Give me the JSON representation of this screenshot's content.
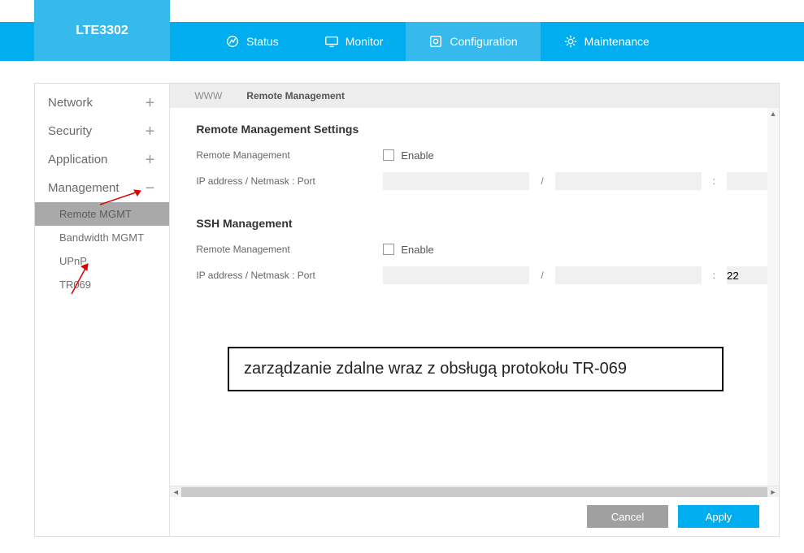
{
  "brand": "LTE3302",
  "nav": {
    "status": "Status",
    "monitor": "Monitor",
    "configuration": "Configuration",
    "maintenance": "Maintenance"
  },
  "sidebar": {
    "network": "Network",
    "security": "Security",
    "application": "Application",
    "management": "Management",
    "sub": {
      "remote": "Remote MGMT",
      "bandwidth": "Bandwidth MGMT",
      "upnp": "UPnP",
      "tr069": "TR069"
    }
  },
  "tabs": {
    "www": "WWW",
    "remote": "Remote Management"
  },
  "section1": {
    "title": "Remote Management Settings",
    "rm_label": "Remote Management",
    "enable": "Enable",
    "ipnp": "IP address / Netmask : Port",
    "port": ""
  },
  "section2": {
    "title": "SSH Management",
    "rm_label": "Remote Management",
    "enable": "Enable",
    "ipnp": "IP address / Netmask : Port",
    "port": "22"
  },
  "sep_slash": "/",
  "sep_colon": ":",
  "annotation": "zarządzanie zdalne wraz z obsługą protokołu TR-069",
  "buttons": {
    "cancel": "Cancel",
    "apply": "Apply"
  },
  "glyph": {
    "plus": "+",
    "minus": "−",
    "left": "◄",
    "right": "►",
    "up": "▲"
  }
}
